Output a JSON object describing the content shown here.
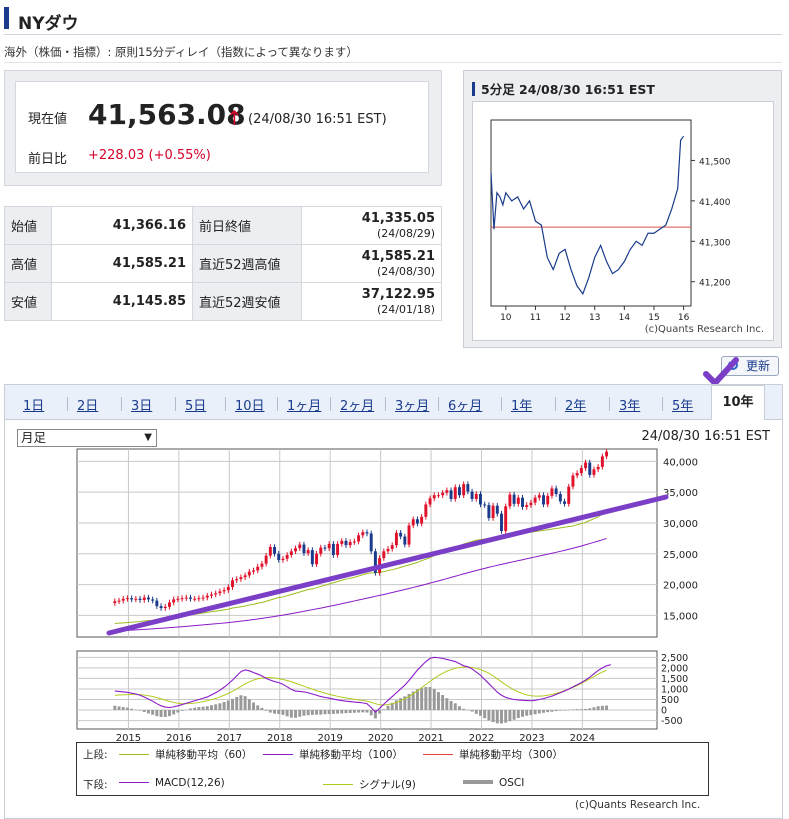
{
  "page": {
    "title": "NYダウ",
    "notice": "海外（株価・指標）: 原則15分ディレイ（指数によって異なります）"
  },
  "quote": {
    "current_label": "現在値",
    "current_value": "41,563.08",
    "arrow": "↑",
    "timestamp": "(24/08/30 16:51 EST)",
    "change_label": "前日比",
    "change_value": "+228.03 (+0.55%)"
  },
  "stats": [
    {
      "label": "始値",
      "value": "41,366.16",
      "label2": "前日終値",
      "value2": "41,335.05",
      "date2": "(24/08/29)"
    },
    {
      "label": "高値",
      "value": "41,585.21",
      "label2": "直近52週高値",
      "value2": "41,585.21",
      "date2": "(24/08/30)"
    },
    {
      "label": "安値",
      "value": "41,145.85",
      "label2": "直近52週安値",
      "value2": "37,122.95",
      "date2": "(24/01/18)"
    }
  ],
  "intraday": {
    "header": "5分足 24/08/30 16:51 EST",
    "copyright": "(c)Quants Research Inc.",
    "colors": {
      "line": "#1a3b8c",
      "prev_close": "#d9534f"
    },
    "chart_data": {
      "type": "line",
      "x_ticks": [
        "10",
        "11",
        "12",
        "13",
        "14",
        "15",
        "16"
      ],
      "y_ticks": [
        "41,500",
        "41,400",
        "41,300",
        "41,200"
      ],
      "ylim": [
        41140,
        41600
      ],
      "xlim": [
        9.5,
        16.25
      ],
      "prev_close": 41335.05,
      "x": [
        9.5,
        9.6,
        9.7,
        9.8,
        9.9,
        10.0,
        10.2,
        10.4,
        10.6,
        10.8,
        11.0,
        11.2,
        11.4,
        11.6,
        11.8,
        12.0,
        12.2,
        12.4,
        12.6,
        12.8,
        13.0,
        13.2,
        13.4,
        13.6,
        13.8,
        14.0,
        14.2,
        14.4,
        14.6,
        14.8,
        15.0,
        15.2,
        15.4,
        15.6,
        15.8,
        15.9,
        16.0
      ],
      "y": [
        41470,
        41330,
        41420,
        41410,
        41390,
        41420,
        41400,
        41410,
        41380,
        41400,
        41350,
        41340,
        41260,
        41230,
        41270,
        41280,
        41230,
        41190,
        41170,
        41210,
        41260,
        41290,
        41250,
        41220,
        41230,
        41250,
        41280,
        41300,
        41290,
        41320,
        41320,
        41330,
        41340,
        41380,
        41430,
        41550,
        41560
      ]
    }
  },
  "refresh_label": "更新",
  "tabs": [
    "1日",
    "2日",
    "3日",
    "5日",
    "10日",
    "1ヶ月",
    "2ヶ月",
    "3ヶ月",
    "6ヶ月",
    "1年",
    "2年",
    "3年",
    "5年",
    "10年"
  ],
  "active_tab": "10年",
  "period_select": "月足",
  "main_timestamp": "24/08/30 16:51 EST",
  "main_chart": {
    "colors": {
      "up": "#e0112b",
      "down": "#1a3b8c",
      "ma60": "#9abd1e",
      "ma100": "#8b1ac9",
      "ma300": "#e0443a",
      "macd": "#8b1ac9",
      "signal": "#b4c81c",
      "osci": "#999999",
      "annotation": "#7a3ec7"
    },
    "chart_data": [
      {
        "type": "candlestick",
        "x_ticks": [
          "2015",
          "2016",
          "2017",
          "2018",
          "2019",
          "2020",
          "2021",
          "2022",
          "2023",
          "2024"
        ],
        "y_ticks": [
          "40,000",
          "35,000",
          "30,000",
          "25,000",
          "20,000",
          "15,000"
        ],
        "ylim": [
          11500,
          42000
        ],
        "xlim": [
          2014.0,
          2025.5
        ],
        "closes": [
          17300,
          17400,
          17700,
          17800,
          17600,
          17700,
          17500,
          17900,
          17600,
          17400,
          16500,
          16200,
          16400,
          17100,
          17600,
          17700,
          17800,
          17900,
          17700,
          17700,
          17800,
          17900,
          18200,
          18400,
          18600,
          18900,
          19100,
          19600,
          20700,
          20900,
          21200,
          21500,
          22100,
          22300,
          22900,
          23400,
          24700,
          26100,
          25000,
          24000,
          24200,
          24800,
          25400,
          25900,
          26500,
          25100,
          25600,
          23300,
          25000,
          26000,
          25900,
          26600,
          24800,
          26600,
          27100,
          26400,
          26900,
          27000,
          28000,
          28500,
          28300,
          25400,
          21900,
          24300,
          25400,
          25800,
          26400,
          28400,
          27800,
          26500,
          29600,
          30600,
          29900,
          31000,
          33000,
          34000,
          34500,
          34500,
          34900,
          35300,
          33900,
          35800,
          34500,
          36300,
          35100,
          33900,
          34700,
          33000,
          32900,
          30800,
          32800,
          31500,
          28700,
          32700,
          34600,
          33100,
          34100,
          32600,
          32900,
          33300,
          34100,
          34500,
          33000,
          34400,
          35600,
          34700,
          33500,
          33100,
          35900,
          37700,
          38100,
          38900,
          39800,
          37800,
          38700,
          39100,
          40800,
          41563
        ],
        "ma60": [
          13700,
          13750,
          13800,
          13850,
          13900,
          13950,
          14000,
          14100,
          14150,
          14200,
          14300,
          14400,
          14500,
          14600,
          14700,
          14800,
          14900,
          15000,
          15100,
          15200,
          15300,
          15400,
          15500,
          15600,
          15700,
          15800,
          15900,
          16000,
          16200,
          16300,
          16400,
          16500,
          16700,
          16800,
          17000,
          17100,
          17300,
          17500,
          17700,
          17900,
          18000,
          18200,
          18400,
          18600,
          18800,
          19000,
          19200,
          19300,
          19500,
          19700,
          19900,
          20100,
          20300,
          20500,
          20700,
          20900,
          21000,
          21200,
          21400,
          21600,
          21800,
          21900,
          21900,
          22000,
          22100,
          22300,
          22400,
          22600,
          22800,
          23000,
          23200,
          23400,
          23600,
          23900,
          24100,
          24400,
          24700,
          25000,
          25300,
          25600,
          25800,
          26100,
          26300,
          26600,
          26800,
          27000,
          27200,
          27300,
          27400,
          27500,
          27600,
          27700,
          27800,
          27900,
          28000,
          28100,
          28200,
          28300,
          28400,
          28500,
          28600,
          28700,
          28800,
          28900,
          29000,
          29100,
          29200,
          29300,
          29400,
          29500,
          29700,
          29900,
          30100,
          30400,
          30700,
          31000,
          31400,
          31800
        ],
        "ma100": [
          12500,
          12520,
          12550,
          12580,
          12620,
          12660,
          12700,
          12740,
          12780,
          12820,
          12870,
          12920,
          12970,
          13020,
          13070,
          13120,
          13170,
          13220,
          13280,
          13340,
          13400,
          13460,
          13520,
          13580,
          13640,
          13700,
          13770,
          13840,
          13910,
          13990,
          14070,
          14150,
          14240,
          14330,
          14420,
          14520,
          14620,
          14720,
          14830,
          14940,
          15050,
          15170,
          15290,
          15410,
          15540,
          15670,
          15800,
          15930,
          16060,
          16190,
          16330,
          16470,
          16610,
          16750,
          16900,
          17050,
          17200,
          17350,
          17500,
          17650,
          17800,
          17950,
          18100,
          18250,
          18400,
          18560,
          18720,
          18880,
          19040,
          19200,
          19370,
          19540,
          19710,
          19880,
          20060,
          20240,
          20420,
          20600,
          20790,
          20980,
          21170,
          21360,
          21550,
          21740,
          21930,
          22110,
          22290,
          22470,
          22640,
          22810,
          22970,
          23130,
          23290,
          23440,
          23590,
          23740,
          23890,
          24040,
          24190,
          24340,
          24490,
          24640,
          24790,
          24940,
          25090,
          25240,
          25400,
          25560,
          25730,
          25900,
          26080,
          26270,
          26460,
          26660,
          26860,
          27060,
          27270,
          27480
        ]
      },
      {
        "type": "macd",
        "x_ticks": [
          "2015",
          "2016",
          "2017",
          "2018",
          "2019",
          "2020",
          "2021",
          "2022",
          "2023",
          "2024"
        ],
        "y_ticks": [
          "2,500",
          "2,000",
          "1,500",
          "1,000",
          "500",
          "0",
          "-500"
        ],
        "ylim": [
          -900,
          2800
        ],
        "xlim": [
          2014.0,
          2025.5
        ],
        "macd": [
          900,
          880,
          860,
          840,
          800,
          760,
          700,
          620,
          520,
          420,
          300,
          200,
          140,
          120,
          150,
          200,
          260,
          320,
          380,
          440,
          500,
          560,
          620,
          720,
          820,
          940,
          1080,
          1240,
          1420,
          1620,
          1820,
          1900,
          1860,
          1780,
          1700,
          1620,
          1500,
          1420,
          1350,
          1300,
          1220,
          1100,
          980,
          900,
          880,
          860,
          820,
          760,
          700,
          640,
          600,
          560,
          520,
          480,
          450,
          420,
          400,
          380,
          360,
          340,
          300,
          120,
          -100,
          80,
          280,
          460,
          640,
          820,
          1000,
          1180,
          1400,
          1650,
          1900,
          2100,
          2300,
          2450,
          2500,
          2480,
          2450,
          2400,
          2350,
          2300,
          2200,
          2100,
          2050,
          1950,
          1800,
          1650,
          1450,
          1250,
          1050,
          850,
          700,
          600,
          540,
          500,
          480,
          460,
          450,
          440,
          460,
          500,
          540,
          600,
          660,
          740,
          820,
          900,
          1000,
          1100,
          1200,
          1300,
          1420,
          1560,
          1720,
          1880,
          2000,
          2100,
          2150
        ],
        "signal": [
          700,
          710,
          720,
          730,
          740,
          740,
          730,
          710,
          680,
          640,
          590,
          530,
          470,
          410,
          360,
          320,
          300,
          300,
          310,
          330,
          360,
          400,
          440,
          490,
          550,
          620,
          700,
          790,
          890,
          1000,
          1120,
          1240,
          1340,
          1420,
          1480,
          1520,
          1540,
          1540,
          1520,
          1490,
          1450,
          1400,
          1340,
          1270,
          1200,
          1130,
          1060,
          990,
          920,
          860,
          800,
          750,
          700,
          650,
          610,
          570,
          540,
          510,
          480,
          450,
          420,
          370,
          300,
          250,
          240,
          260,
          300,
          360,
          440,
          530,
          640,
          770,
          910,
          1060,
          1210,
          1360,
          1500,
          1630,
          1740,
          1840,
          1920,
          1980,
          2020,
          2040,
          2040,
          2020,
          1980,
          1920,
          1840,
          1740,
          1620,
          1480,
          1340,
          1200,
          1070,
          960,
          860,
          780,
          720,
          680,
          660,
          660,
          670,
          700,
          740,
          790,
          850,
          920,
          990,
          1070,
          1160,
          1260,
          1370,
          1480,
          1590,
          1700,
          1800,
          1890
        ]
      }
    ]
  },
  "main_copyright": "(c)Quants Research Inc.",
  "legend": {
    "upper_label": "上段:",
    "lower_label": "下段:",
    "ma60": "単純移動平均（60）",
    "ma100": "単純移動平均（100）",
    "ma300": "単純移動平均（300）",
    "macd": "MACD(12,26)",
    "signal": "シグナル(9)",
    "osci": "OSCI"
  }
}
